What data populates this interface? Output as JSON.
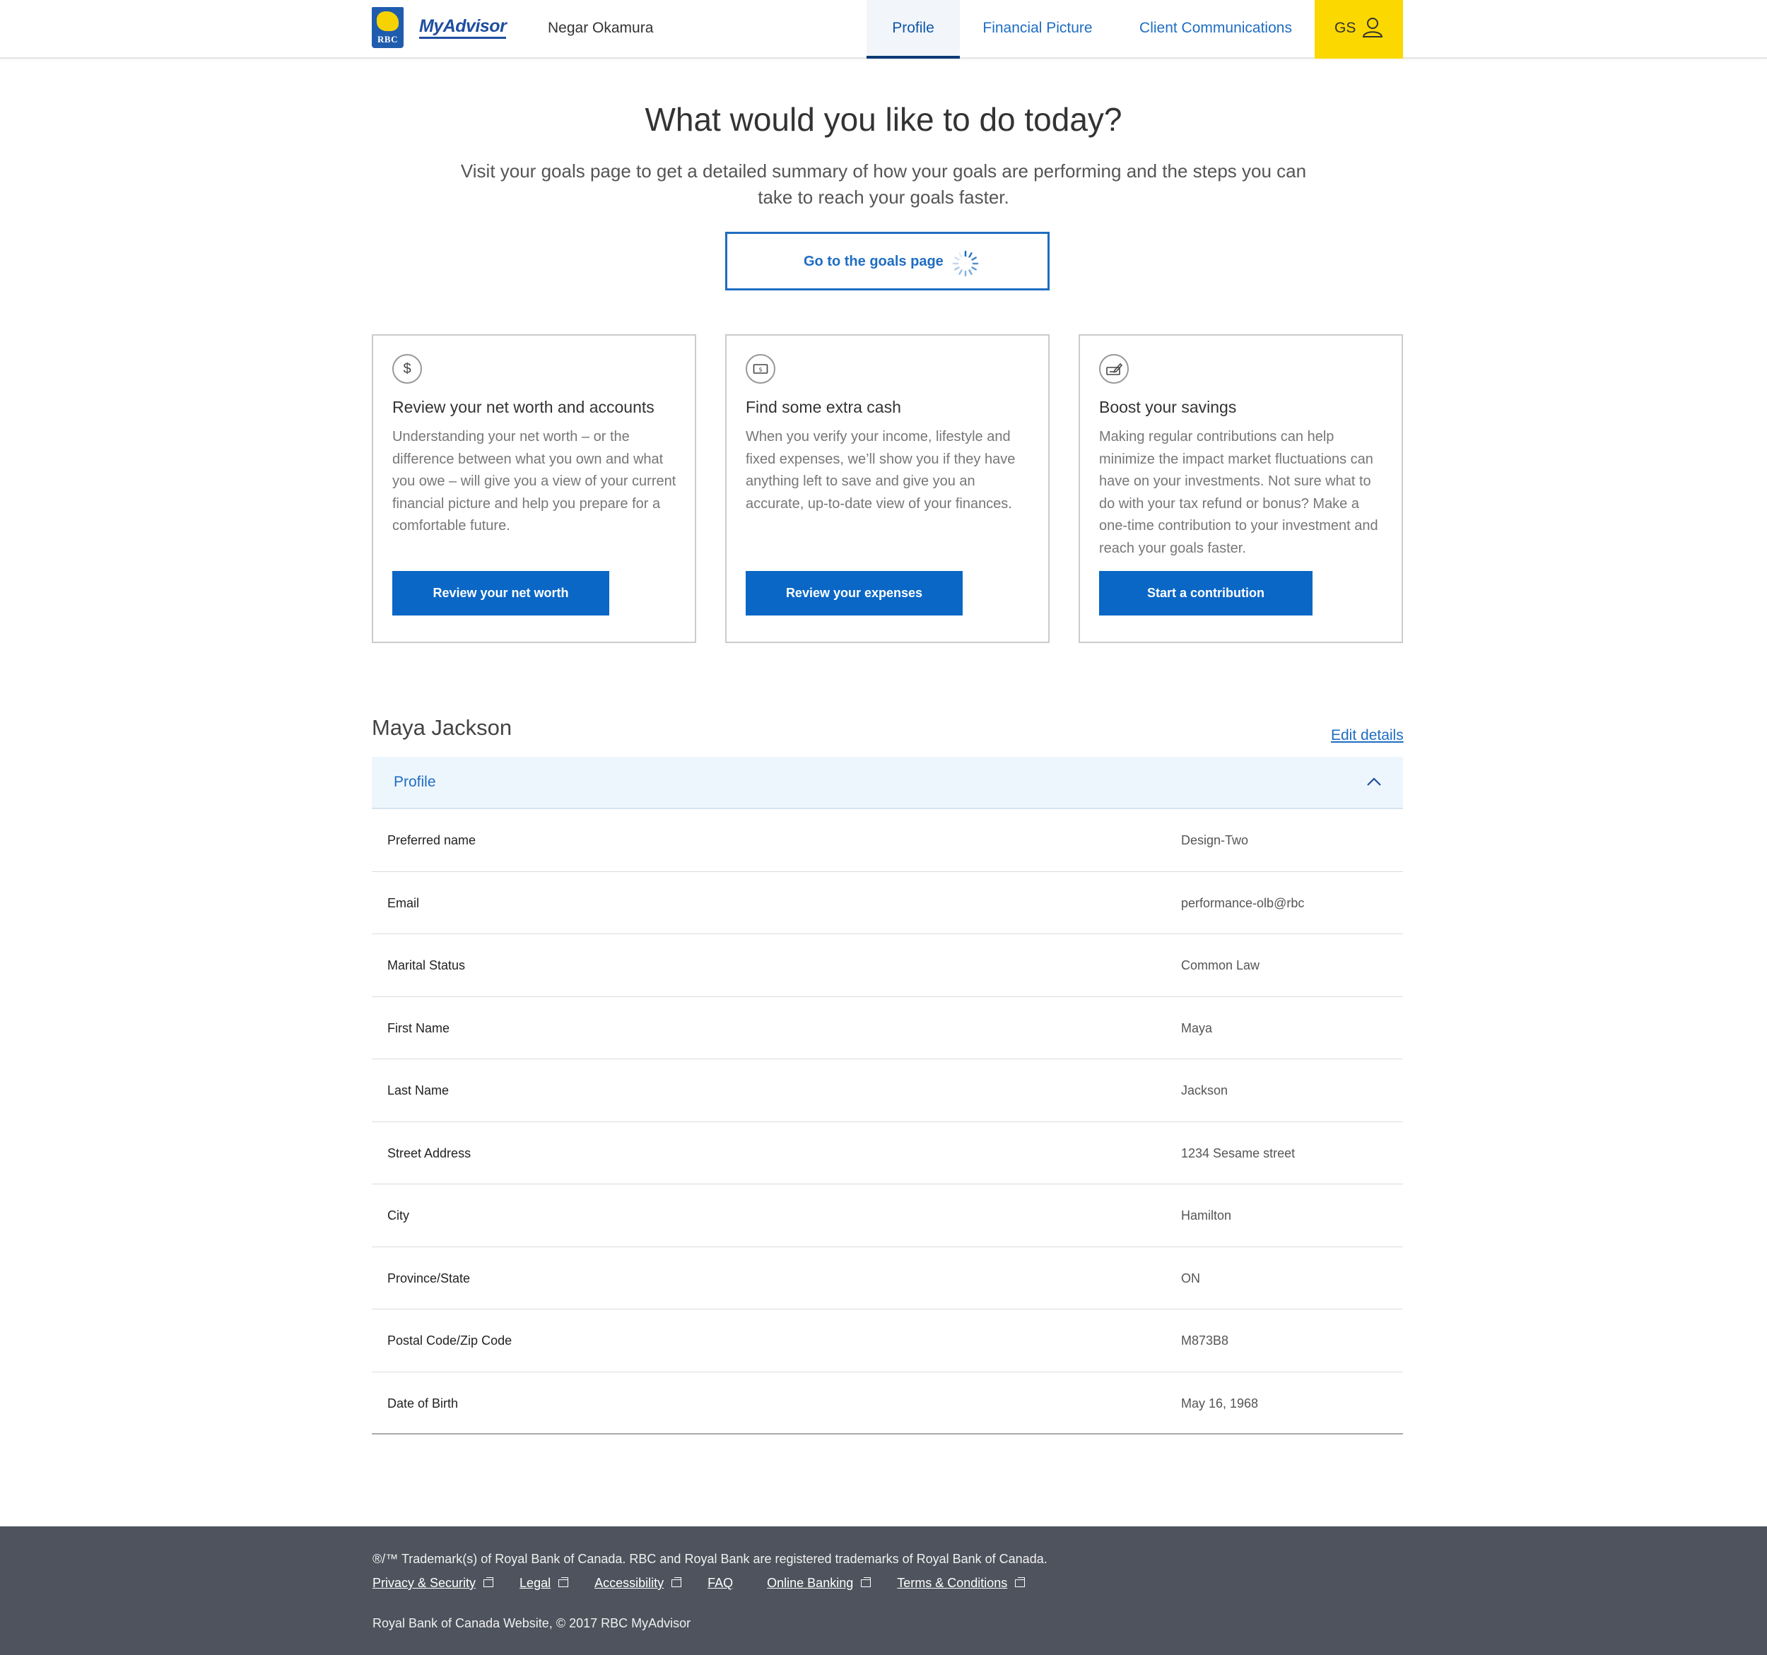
{
  "header": {
    "logo_text": "RBC",
    "brand": "MyAdvisor",
    "advisor_name": "Negar Okamura",
    "nav": [
      {
        "label": "Profile",
        "active": true
      },
      {
        "label": "Financial Picture",
        "active": false
      },
      {
        "label": "Client Communications",
        "active": false
      }
    ],
    "user_initials": "GS",
    "accent_color": "#fbd800",
    "link_color": "#1f6dc2"
  },
  "hero": {
    "title": "What would you like to do today?",
    "subtitle": "Visit your goals page to get a detailed summary of how your goals are performing and the steps you can take to reach your goals faster.",
    "goals_button": "Go to the goals page",
    "goals_button_icon": "loading-spinner-icon"
  },
  "cards": [
    {
      "icon": "dollar-icon",
      "icon_glyph": "$",
      "title": "Review your net worth and accounts",
      "text": "Understanding your net worth – or the difference between what you own and what you owe – will give you a view of your current financial picture and help you prepare for a comfortable future.",
      "button": "Review your net worth"
    },
    {
      "icon": "cash-bill-icon",
      "title": "Find some extra cash",
      "text": "When you verify your income, lifestyle and fixed expenses, we’ll show you if they have anything left to save and give you an accurate, up-to-date view of your finances.",
      "button": "Review your expenses"
    },
    {
      "icon": "savings-cheque-icon",
      "title": "Boost your savings",
      "text": "Making regular contributions can help minimize the impact market fluctuations can have on your investments. Not sure what to do with your tax refund or bonus? Make a one-time contribution to your investment and reach your goals faster.",
      "button": "Start a contribution"
    }
  ],
  "profile": {
    "client_name": "Maya Jackson",
    "edit_link": "Edit details",
    "section_label": "Profile",
    "expanded": true,
    "rows": [
      {
        "label": "Preferred name",
        "value": "Design-Two"
      },
      {
        "label": "Email",
        "value": "performance-olb@rbc"
      },
      {
        "label": "Marital Status",
        "value": "Common Law"
      },
      {
        "label": "First Name",
        "value": "Maya"
      },
      {
        "label": "Last Name",
        "value": "Jackson"
      },
      {
        "label": "Street Address",
        "value": "1234 Sesame street"
      },
      {
        "label": "City",
        "value": "Hamilton"
      },
      {
        "label": "Province/State",
        "value": "ON"
      },
      {
        "label": "Postal Code/Zip Code",
        "value": "M873B8"
      },
      {
        "label": "Date of Birth",
        "value": "May 16, 1968"
      }
    ]
  },
  "footer": {
    "trademark": "®/™ Trademark(s) of Royal Bank of Canada. RBC and Royal Bank are registered trademarks of Royal Bank of Canada.",
    "links": [
      {
        "label": "Privacy & Security",
        "external": true
      },
      {
        "label": "Legal",
        "external": true
      },
      {
        "label": "Accessibility",
        "external": true
      },
      {
        "label": "FAQ",
        "external": false
      },
      {
        "label": "Online Banking",
        "external": true
      },
      {
        "label": "Terms & Conditions",
        "external": true
      }
    ],
    "copyright": "Royal Bank of Canada Website, © 2017 RBC MyAdvisor",
    "background": "#4e535d"
  }
}
